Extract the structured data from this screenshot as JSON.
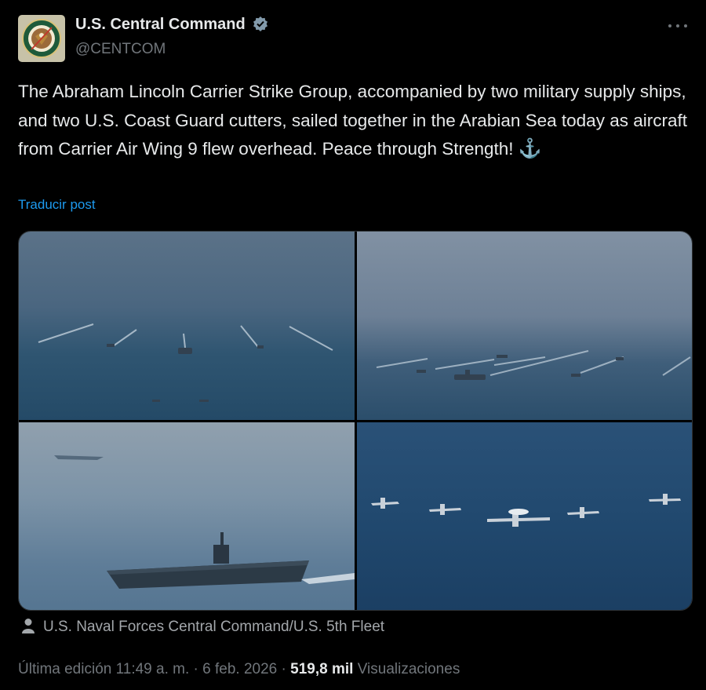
{
  "account": {
    "name": "U.S. Central Command",
    "handle": "@CENTCOM",
    "verified_icon": "verified-badge-icon"
  },
  "tweet": {
    "text": "The Abraham Lincoln Carrier Strike Group, accompanied by two military supply ships, and two U.S. Coast Guard cutters, sailed together in the Arabian Sea today as aircraft from Carrier Air Wing 9 flew overhead. Peace through Strength!",
    "emoji": "⚓",
    "translate_label": "Traducir post"
  },
  "media": {
    "photos": [
      {
        "subject": "ships-formation-foggy"
      },
      {
        "subject": "ships-formation-wide"
      },
      {
        "subject": "aircraft-carrier"
      },
      {
        "subject": "aircraft-formation"
      }
    ],
    "credit": "U.S. Naval Forces Central Command/U.S. 5th Fleet"
  },
  "meta": {
    "edited_label": "Última edición",
    "time": "11:49 a. m.",
    "separator": "·",
    "date": "6 feb. 2026",
    "views_count": "519,8 mil",
    "views_label": "Visualizaciones"
  },
  "colors": {
    "background": "#000000",
    "text": "#e7e9ea",
    "secondary": "#71767b",
    "accent": "#1d9bf0"
  }
}
